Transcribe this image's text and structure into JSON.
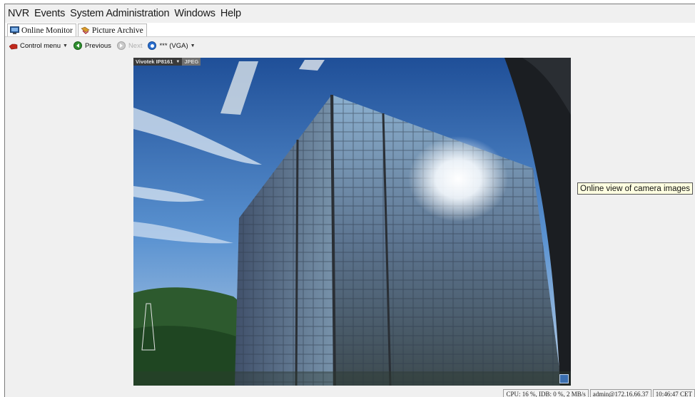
{
  "menubar": {
    "items": [
      "NVR",
      "Events",
      "System Administration",
      "Windows",
      "Help"
    ]
  },
  "tabs": [
    {
      "label": "Online Monitor",
      "icon": "monitor-icon"
    },
    {
      "label": "Picture Archive",
      "icon": "archive-icon"
    }
  ],
  "toolbar": {
    "control_menu": "Control menu",
    "previous": "Previous",
    "next": "Next",
    "resolution": "*** (VGA)"
  },
  "camera": {
    "name": "Vivotek IP8161",
    "format": "JPEG"
  },
  "tooltip": "Online view of camera images",
  "statusbar": {
    "cpu": "CPU: 16 %, IDB: 0 %, 2 MB/s",
    "user": "admin@172.16.66.37",
    "time": "10:46:47 CET"
  },
  "colors": {
    "window_bg": "#f0f0f0",
    "sky": "#4f86c6",
    "tooltip_bg": "#ffffe1"
  }
}
